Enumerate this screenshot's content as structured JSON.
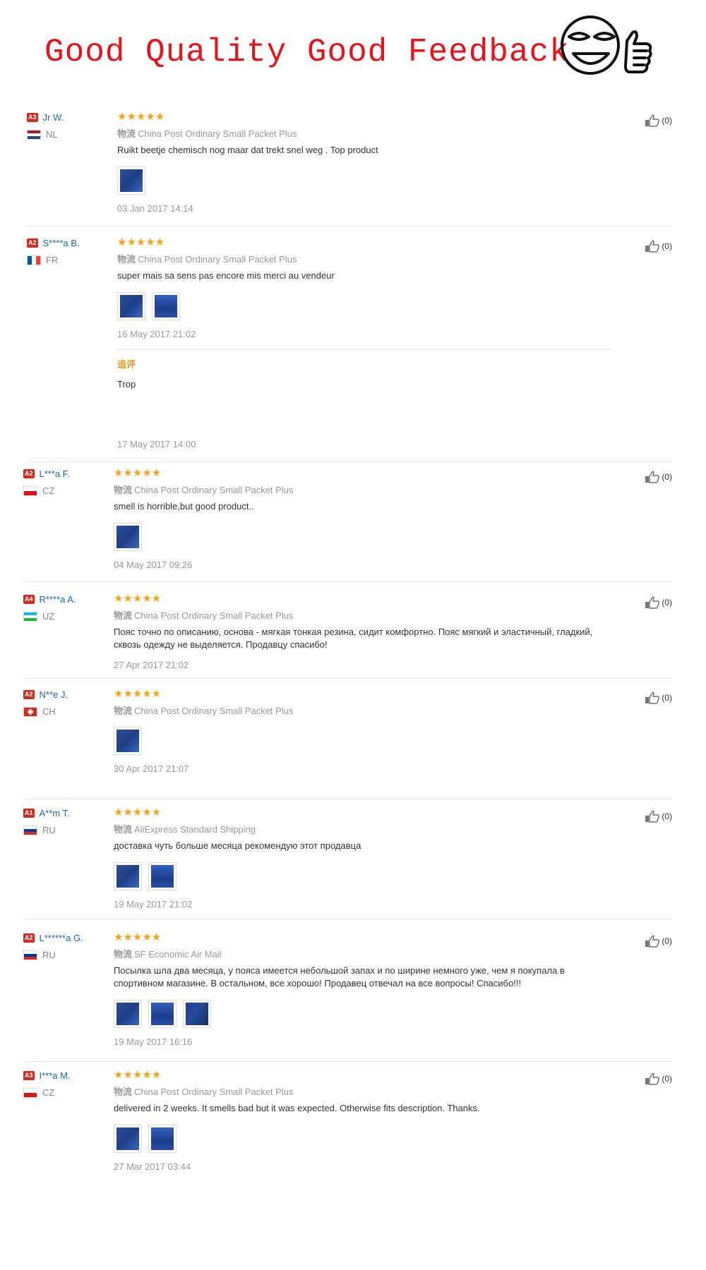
{
  "banner": {
    "title": "Good Quality Good Feedback",
    "accent": "#e8121b",
    "icon": "smiley-thumbs-up-icon"
  },
  "colors": {
    "star": "#f7a21b",
    "username": "#1a66a8",
    "badge": "#d52a1e",
    "followup_label": "#f0951b"
  },
  "reviews": [
    {
      "level": "A3",
      "name": "Jr W.",
      "country": "NL",
      "stars": "★★★★★",
      "ship_label": "物流",
      "shipping": "China Post Ordinary Small Packet Plus",
      "text": "Ruikt beetje chemisch nog maar dat trekt snel weg . Top product",
      "date": "03 Jan 2017 14:14",
      "likes": "(0)",
      "photos": 1
    },
    {
      "level": "A2",
      "name": "S****a B.",
      "country": "FR",
      "stars": "★★★★★",
      "ship_label": "物流",
      "shipping": "China Post Ordinary Small Packet Plus",
      "text": "super mais sa sens pas encore mis merci au vendeur",
      "date": "16 May 2017 21:02",
      "likes": "(0)",
      "photos": 2,
      "followup": {
        "label": "追评",
        "text": "Trop",
        "date": "17 May 2017 14:00"
      }
    },
    {
      "level": "A2",
      "name": "L***a F.",
      "country": "CZ",
      "stars": "★★★★★",
      "ship_label": "物流",
      "shipping": "China Post Ordinary Small Packet Plus",
      "text": "smell is horrible,but good product..",
      "date": "04 May 2017 09:26",
      "likes": "(0)",
      "photos": 1
    },
    {
      "level": "A4",
      "name": "R****a A.",
      "country": "UZ",
      "stars": "★★★★★",
      "ship_label": "物流",
      "shipping": "China Post Ordinary Small Packet Plus",
      "text": "Пояс точно по описанию, основа - мягкая тонкая резина, сидит комфортно. Пояс мягкий и эластичный, гладкий, сквозь одежду не выделяется. Продавцу спасибо!",
      "date": "27 Apr 2017 21:02",
      "likes": "(0)",
      "photos": 0
    },
    {
      "level": "A2",
      "name": "N**e J.",
      "country": "CH",
      "stars": "★★★★★",
      "ship_label": "物流",
      "shipping": "China Post Ordinary Small Packet Plus",
      "text": "",
      "date": "30 Apr 2017 21:07",
      "likes": "(0)",
      "photos": 1
    },
    {
      "level": "A1",
      "name": "A**m T.",
      "country": "RU",
      "stars": "★★★★★",
      "ship_label": "物流",
      "shipping": "AliExpress Standard Shipping",
      "text": "доставка чуть больше месяца рекомендую этот продавца",
      "date": "19 May 2017 21:02",
      "likes": "(0)",
      "photos": 2
    },
    {
      "level": "A2",
      "name": "L******a G.",
      "country": "RU",
      "stars": "★★★★★",
      "ship_label": "物流",
      "shipping": "SF Economic Air Mail",
      "text": "Посылка шла два месяца, у пояса имеется небольшой запах и по ширине немного уже, чем я покупала в спортивном магазине. В остальном, все хорошо! Продавец отвечал на все вопросы! Спасибо!!!",
      "date": "19 May 2017 16:16",
      "likes": "(0)",
      "photos": 3
    },
    {
      "level": "A3",
      "name": "I***a M.",
      "country": "CZ",
      "stars": "★★★★★",
      "ship_label": "物流",
      "shipping": "China Post Ordinary Small Packet Plus",
      "text": "delivered in 2 weeks. It smells bad but it was expected. Otherwise fits description. Thanks.",
      "date": "27 Mar 2017 03:44",
      "likes": "(0)",
      "photos": 2
    }
  ]
}
